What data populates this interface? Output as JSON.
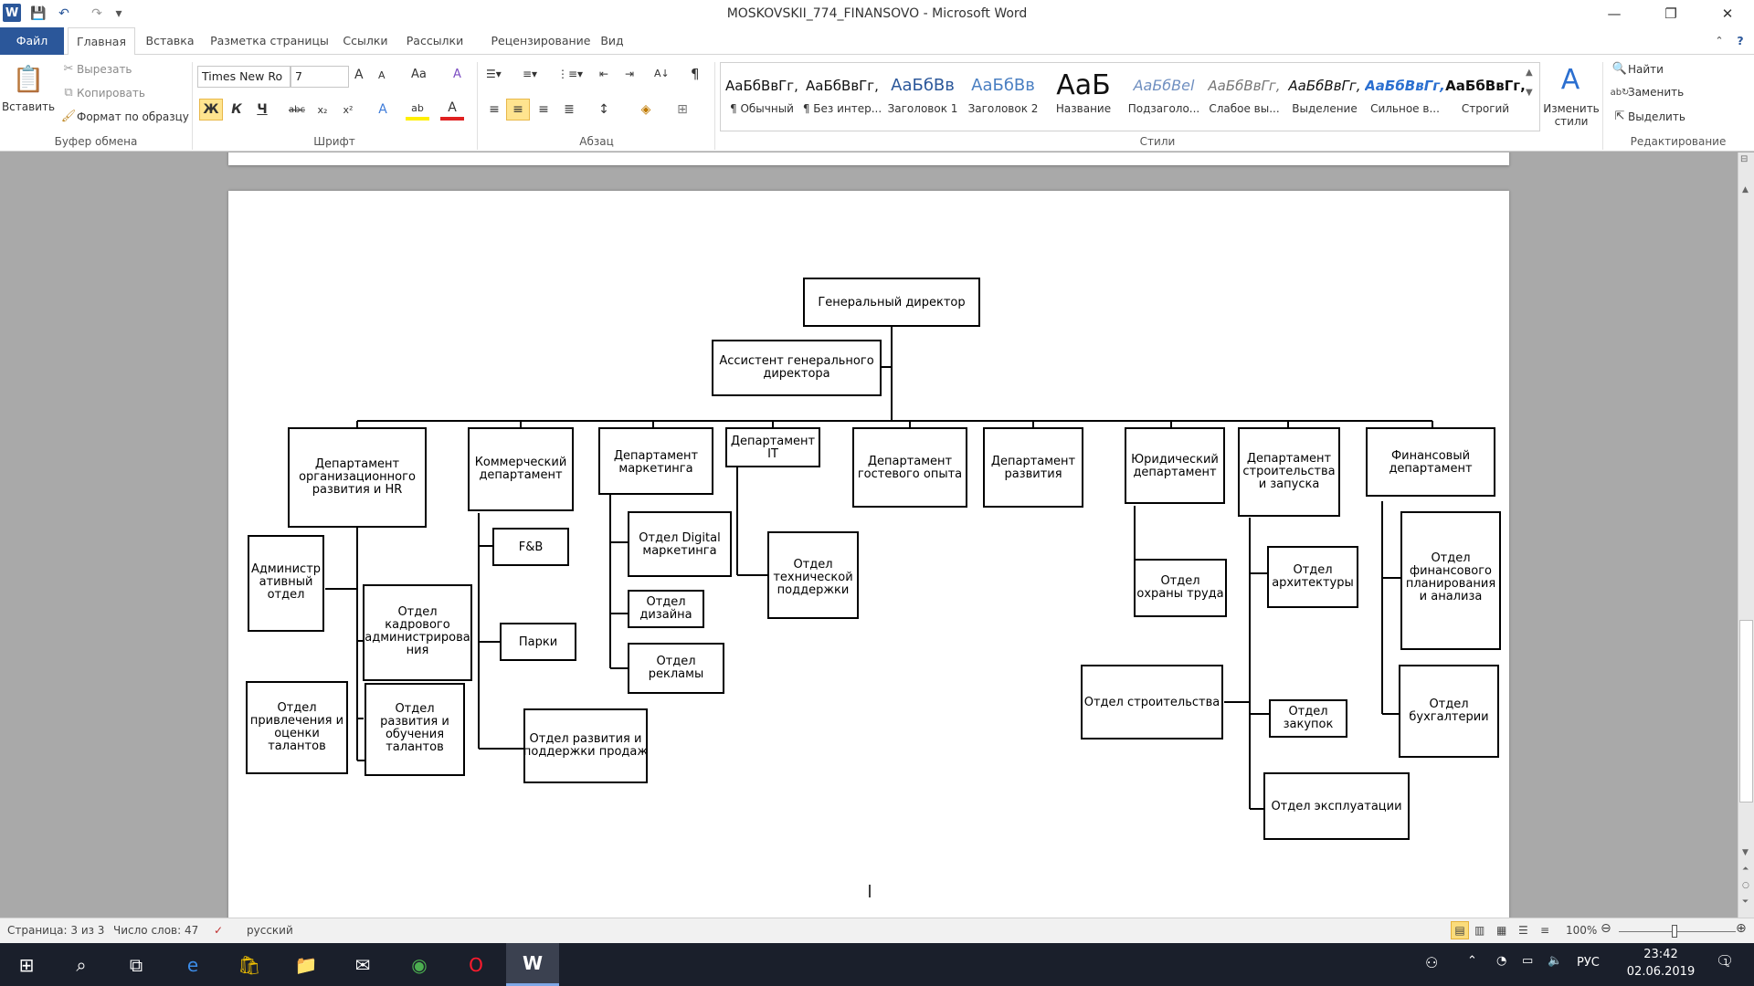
{
  "window": {
    "title": "MOSKOVSKII_774_FINANSOVO  -  Microsoft Word"
  },
  "quick_access": {
    "app_icon": "W",
    "save": "💾",
    "undo": "↶",
    "redo": "↷",
    "customize": "▾"
  },
  "window_controls": {
    "minimize": "—",
    "restore": "❐",
    "close": "✕",
    "help": "?"
  },
  "tabs": [
    "Файл",
    "Главная",
    "Вставка",
    "Разметка страницы",
    "Ссылки",
    "Рассылки",
    "Рецензирование",
    "Вид"
  ],
  "ribbon": {
    "clipboard": {
      "paste": "Вставить",
      "cut": "Вырезать",
      "copy": "Копировать",
      "format_painter": "Формат по образцу",
      "label": "Буфер обмена"
    },
    "font": {
      "name": "Times New Ro",
      "size": "7",
      "grow": "A",
      "shrink": "A",
      "change_case": "Aa",
      "clear": "A",
      "bold": "Ж",
      "italic": "К",
      "underline": "Ч",
      "strike": "abc",
      "sub": "x₂",
      "sup": "x²",
      "effects": "A",
      "highlight": "ab",
      "color": "A",
      "label": "Шрифт"
    },
    "paragraph": {
      "pilcrow": "¶",
      "sort": "A↓",
      "label": "Абзац"
    },
    "styles": {
      "items": [
        {
          "preview": "АаБбВвГг,",
          "label": "¶ Обычный"
        },
        {
          "preview": "АаБбВвГг,",
          "label": "¶ Без интер..."
        },
        {
          "preview": "АаБбВв",
          "label": "Заголовок 1"
        },
        {
          "preview": "АаБбВв",
          "label": "Заголовок 2"
        },
        {
          "preview": "АаБ",
          "label": "Название"
        },
        {
          "preview": "АаБбВеl",
          "label": "Подзаголо..."
        },
        {
          "preview": "АаБбВвГг,",
          "label": "Слабое вы..."
        },
        {
          "preview": "АаБбВвГг,",
          "label": "Выделение"
        },
        {
          "preview": "АаБбВвГг,",
          "label": "Сильное в..."
        },
        {
          "preview": "АаБбВвГг,",
          "label": "Строгий"
        }
      ],
      "change_styles": "Изменить стили",
      "label": "Стили"
    },
    "editing": {
      "find": "Найти",
      "replace": "Заменить",
      "select": "Выделить",
      "label": "Редактирование"
    }
  },
  "org_chart": {
    "director": "Генеральный  директор",
    "assistant": [
      "Ассистент генерального",
      "директора"
    ],
    "departments": [
      {
        "lines": [
          "Департамент",
          "организационного",
          "развития  и HR"
        ]
      },
      {
        "lines": [
          "Коммерческий",
          "департамент"
        ]
      },
      {
        "lines": [
          "Департамент",
          "маркетинга"
        ]
      },
      {
        "lines": [
          "Департамент",
          "IT"
        ]
      },
      {
        "lines": [
          "Департамент",
          "гостевого опыта"
        ]
      },
      {
        "lines": [
          "Департамент",
          "развития"
        ]
      },
      {
        "lines": [
          "Юридический",
          "департамент"
        ]
      },
      {
        "lines": [
          "Департамент",
          "строительства",
          "и запуска"
        ]
      },
      {
        "lines": [
          "Финансовый",
          "департамент"
        ]
      }
    ],
    "units": {
      "admin": [
        "Администр",
        "ативный",
        "отдел"
      ],
      "hr_admin": [
        "Отдел",
        "кадрового",
        "администрирова",
        "ния"
      ],
      "talent_attract": [
        "Отдел",
        "привлечения  и",
        "оценки",
        "талантов"
      ],
      "talent_train": [
        "Отдел",
        "развития и",
        "обучения",
        "талантов"
      ],
      "fb": [
        "F&B"
      ],
      "parks": [
        "Парки"
      ],
      "sales": [
        "Отдел развития  и",
        "поддержки  продаж"
      ],
      "digital": [
        "Отдел Digital",
        "маркетинга"
      ],
      "design": [
        "Отдел",
        "дизайна"
      ],
      "ads": [
        "Отдел",
        "рекламы"
      ],
      "tech_support": [
        "Отдел",
        "технической",
        "поддержки"
      ],
      "labor": [
        "Отдел",
        "охраны  труда"
      ],
      "architecture": [
        "Отдел",
        "архитектуры"
      ],
      "construction": [
        "Отдел  строительства"
      ],
      "purchasing": [
        "Отдел",
        "закупок"
      ],
      "operations": [
        "Отдел  эксплуатации"
      ],
      "fin_planning": [
        "Отдел",
        "финансового",
        "планирования",
        "и  анализа"
      ],
      "accounting": [
        "Отдел",
        "бухгалтерии"
      ]
    }
  },
  "status": {
    "page": "Страница: 3 из 3",
    "words": "Число слов: 47",
    "language": "русский",
    "zoom": "100%"
  },
  "taskbar": {
    "language": "РУС",
    "time": "23:42",
    "date": "02.06.2019",
    "notifications": "1"
  }
}
